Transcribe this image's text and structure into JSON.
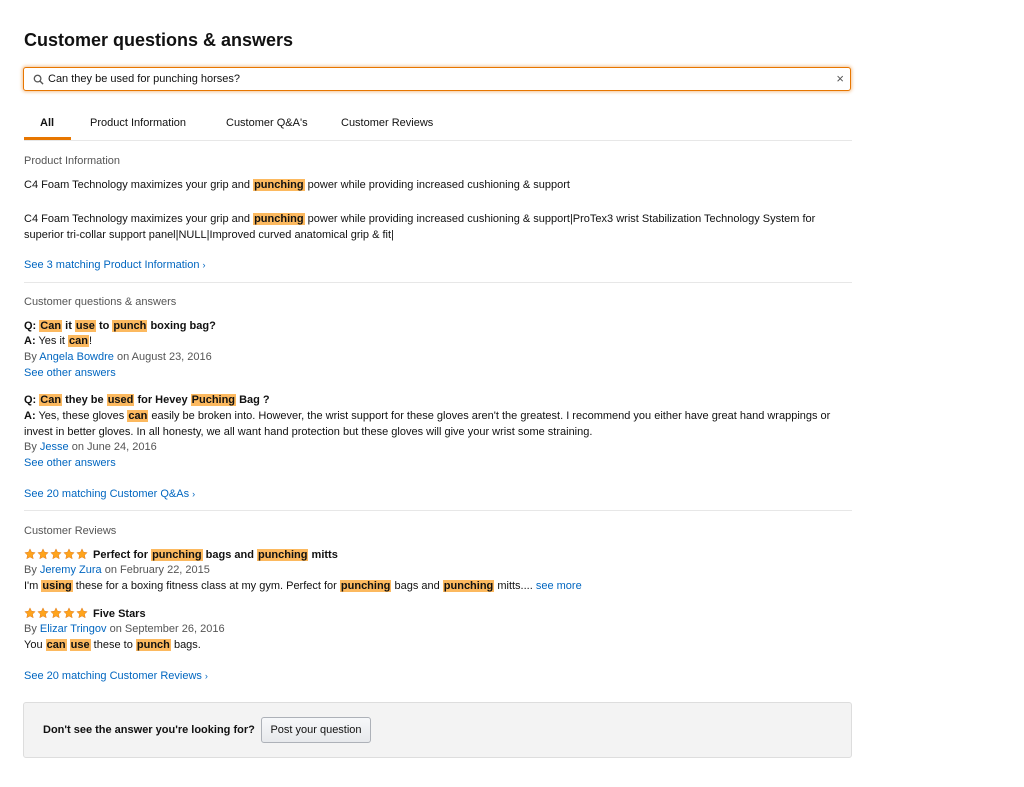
{
  "page": {
    "title": "Customer questions & answers"
  },
  "search": {
    "value": "Can they be used for punching horses?",
    "clear_label": "×"
  },
  "tabs": [
    {
      "label": "All"
    },
    {
      "label": "Product Information"
    },
    {
      "label": "Customer Q&A's"
    },
    {
      "label": "Customer Reviews"
    }
  ],
  "product_info": {
    "heading": "Product Information",
    "item1": {
      "t1": "C4 Foam Technology maximizes your grip and ",
      "hl1": "punching",
      "t2": " power while providing increased cushioning & support"
    },
    "item2": {
      "t1": "C4 Foam Technology maximizes your grip and ",
      "hl1": "punching",
      "t2": " power while providing increased cushioning & support|ProTex3 wrist Stabilization Technology System for",
      "line2": "superior tri-collar support panel|NULL|Improved curved anatomical grip & fit|"
    },
    "see_more": "See 3 matching Product Information",
    "chevron": "›"
  },
  "qa": {
    "heading": "Customer questions & answers",
    "q1": {
      "q_prefix": "Q:",
      "w1": "Can",
      "t1": " it ",
      "w2": "use",
      "t2": " to ",
      "w3": "punch",
      "t3": " boxing bag?",
      "a_prefix": "A:",
      "a_t1": " Yes it ",
      "a_w1": "can",
      "a_t2": "!",
      "by": "By ",
      "author": "Angela Bowdre",
      "date": " on August 23, 2016",
      "other": "See other answers"
    },
    "q2": {
      "q_prefix": "Q:",
      "w1": "Can",
      "t1": " they be ",
      "w2": "used",
      "t2": " for Hevey ",
      "w3": "Puching",
      "t3": " Bag ?",
      "a_prefix": "A:",
      "a_t1": " Yes, these gloves ",
      "a_w1": "can",
      "a_t2": " easily be broken into. However, the wrist support for these gloves aren't the greatest. I recommend you either have great hand wrappings or",
      "a_line2": "invest in better gloves. In all honesty, we all want hand protection but these gloves will give your wrist some straining.",
      "by": "By ",
      "author": "Jesse",
      "date": " on June 24, 2016",
      "other": "See other answers"
    },
    "see_more": "See 20 matching Customer Q&As",
    "chevron": "›"
  },
  "reviews": {
    "heading": "Customer Reviews",
    "r1": {
      "rating": 5,
      "title_t1": "Perfect for ",
      "title_w1": "punching",
      "title_t2": " bags and ",
      "title_w2": "punching",
      "title_t3": " mitts",
      "by": "By ",
      "author": "Jeremy Zura",
      "date": " on February 22, 2015",
      "b_t1": "I'm ",
      "b_w1": "using",
      "b_t2": " these for a boxing fitness class at my gym. Perfect for ",
      "b_w2": "punching",
      "b_t3": " bags and ",
      "b_w3": "punching",
      "b_t4": " mitts.... ",
      "see_more": "see more"
    },
    "r2": {
      "rating": 5,
      "title": "Five Stars",
      "by": "By ",
      "author": "Elizar Tringov",
      "date": " on September 26, 2016",
      "b_t1": "You ",
      "b_w1": "can",
      "b_t2": " ",
      "b_w2": "use",
      "b_t3": " these to ",
      "b_w3": "punch",
      "b_t4": " bags."
    },
    "see_more": "See 20 matching Customer Reviews",
    "chevron": "›"
  },
  "footer": {
    "prompt": "Don't see the answer you're looking for?",
    "button": "Post your question"
  },
  "colors": {
    "accent": "#e77600",
    "highlight": "#fcb95f",
    "link": "#0066c0",
    "star": "#ffa41c"
  },
  "icons": {
    "search": "search-icon",
    "clear": "close-icon",
    "star": "star-icon"
  }
}
